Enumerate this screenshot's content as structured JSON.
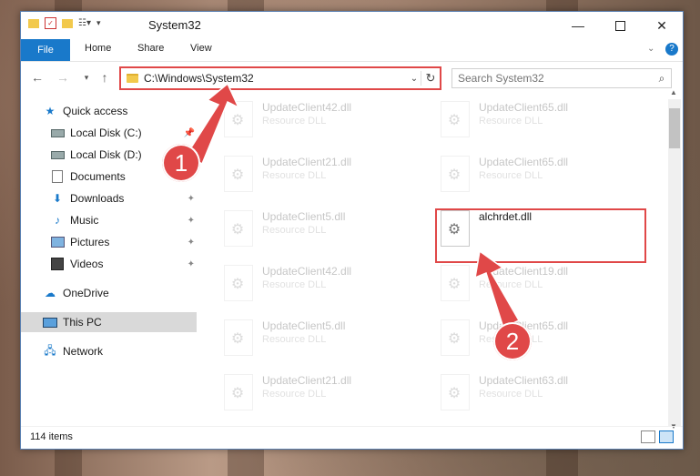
{
  "window": {
    "title": "System32"
  },
  "ribbon": {
    "file_label": "File",
    "home_label": "Home",
    "share_label": "Share",
    "view_label": "View"
  },
  "address": {
    "path": "C:\\Windows\\System32"
  },
  "search": {
    "placeholder": "Search System32"
  },
  "sidebar": {
    "items": [
      {
        "label": "Quick access",
        "icon": "star-icon"
      },
      {
        "label": "Local Disk (C:)",
        "icon": "drive-icon"
      },
      {
        "label": "Local Disk (D:)",
        "icon": "drive-icon"
      },
      {
        "label": "Documents",
        "icon": "documents-icon"
      },
      {
        "label": "Downloads",
        "icon": "download-icon"
      },
      {
        "label": "Music",
        "icon": "music-icon"
      },
      {
        "label": "Pictures",
        "icon": "pictures-icon"
      },
      {
        "label": "Videos",
        "icon": "videos-icon"
      },
      {
        "label": "OneDrive",
        "icon": "cloud-icon"
      },
      {
        "label": "This PC",
        "icon": "computer-icon"
      },
      {
        "label": "Network",
        "icon": "network-icon"
      }
    ]
  },
  "files": [
    {
      "name": "UpdateClient42.dll",
      "type": "Resource DLL"
    },
    {
      "name": "UpdateClient65.dll",
      "type": "Resource DLL"
    },
    {
      "name": "UpdateClient21.dll",
      "type": "Resource DLL"
    },
    {
      "name": "UpdateClient65.dll",
      "type": "Resource DLL"
    },
    {
      "name": "UpdateClient5.dll",
      "type": "Resource DLL"
    },
    {
      "name": "alchrdet.dll",
      "type": ""
    },
    {
      "name": "UpdateClient42.dll",
      "type": "Resource DLL"
    },
    {
      "name": "UpdateClient19.dll",
      "type": "Resource DLL"
    },
    {
      "name": "UpdateClient5.dll",
      "type": "Resource DLL"
    },
    {
      "name": "UpdateClient65.dll",
      "type": "Resource DLL"
    },
    {
      "name": "UpdateClient21.dll",
      "type": "Resource DLL"
    },
    {
      "name": "UpdateClient63.dll",
      "type": "Resource DLL"
    }
  ],
  "status": {
    "item_count": "114 items"
  },
  "callouts": {
    "one": "1",
    "two": "2"
  },
  "colors": {
    "accent": "#1979ca",
    "highlight": "#e04848"
  }
}
